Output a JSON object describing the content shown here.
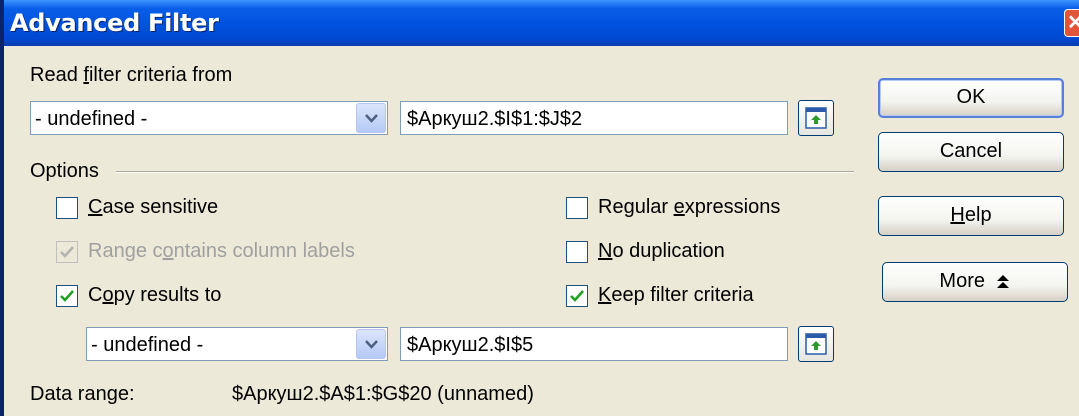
{
  "window": {
    "title": "Advanced Filter",
    "close_glyph": "✕"
  },
  "criteria": {
    "label_pre": "Read ",
    "label_key": "f",
    "label_post": "ilter criteria from",
    "combo_value": "- undefined -",
    "range_value": "$Аркуш2.$I$1:$J$2"
  },
  "options": {
    "label": "Options",
    "case_sensitive": {
      "key": "C",
      "rest": "ase sensitive",
      "checked": false
    },
    "range_labels": {
      "pre": "Range c",
      "key": "o",
      "post": "ntains column labels",
      "checked": true,
      "disabled": true
    },
    "copy_results": {
      "pre": "C",
      "key": "o",
      "post": "py results to",
      "checked": true
    },
    "regex": {
      "pre": "Regular ",
      "key": "e",
      "post": "xpressions",
      "checked": false
    },
    "no_dup": {
      "key": "N",
      "rest": "o duplication",
      "checked": false
    },
    "keep": {
      "key": "K",
      "rest": "eep filter criteria",
      "checked": true
    }
  },
  "copy_to": {
    "combo_value": "- undefined -",
    "range_value": "$Аркуш2.$I$5"
  },
  "data_range": {
    "label": "Data range:",
    "value": "$Аркуш2.$A$1:$G$20 (unnamed)"
  },
  "buttons": {
    "ok": "OK",
    "cancel": "Cancel",
    "help_key": "H",
    "help_rest": "elp",
    "more": "More",
    "more_glyph": "⬆"
  },
  "icons": [
    "close-icon",
    "chevron-down-icon",
    "shrink-icon",
    "checkmark-icon",
    "double-chevron-up-icon"
  ]
}
